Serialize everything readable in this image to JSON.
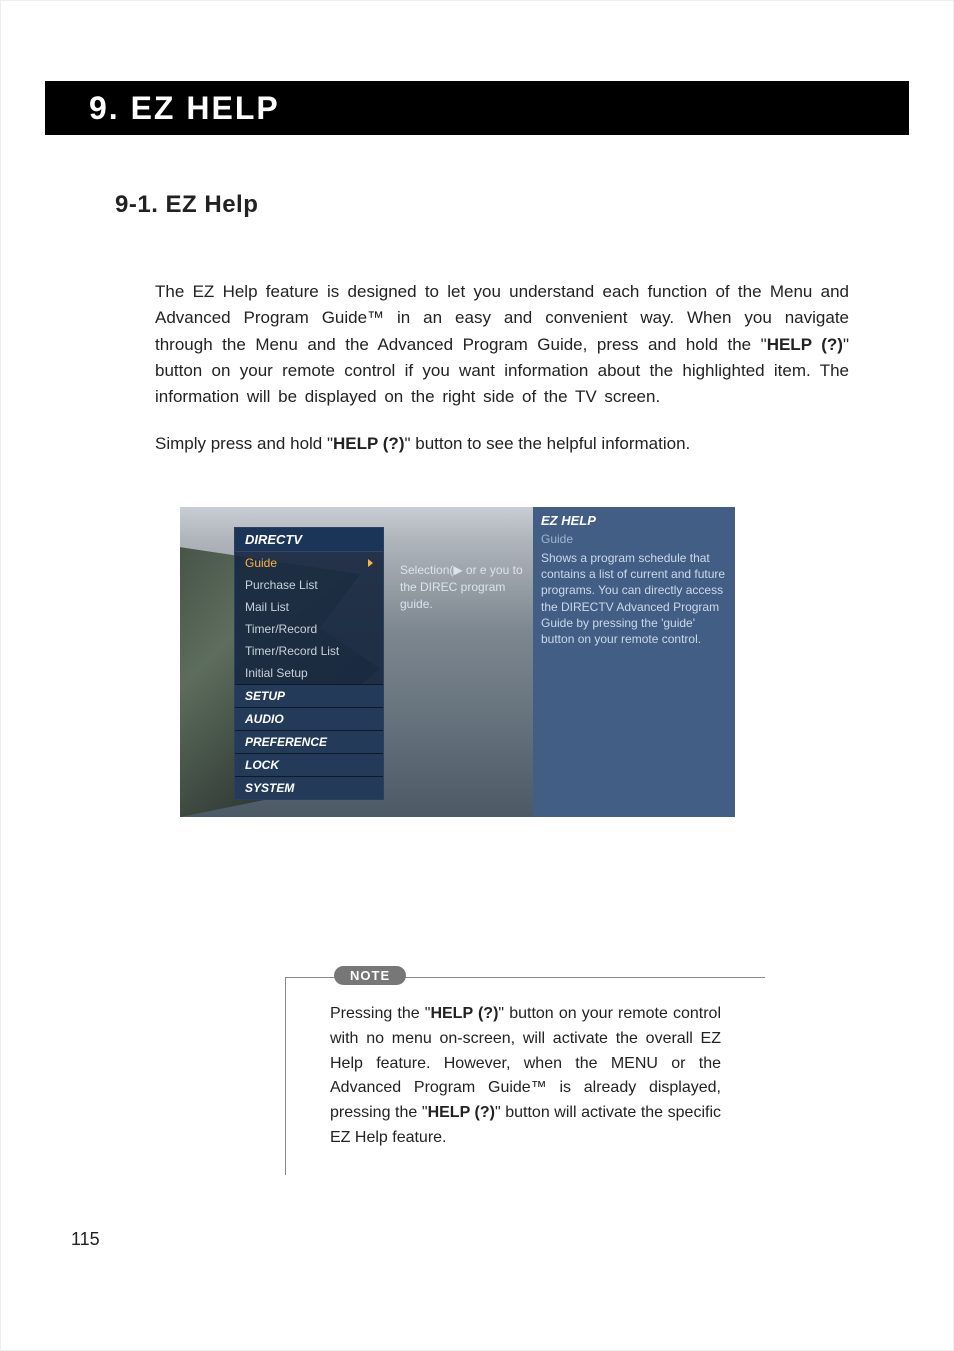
{
  "chapter": {
    "title": "9. EZ HELP"
  },
  "section": {
    "heading": "9-1. EZ Help"
  },
  "paragraphs": {
    "p1a": "The EZ Help feature is designed to let you understand each function of the Menu and Advanced Program Guide™ in an easy and convenient way.  When you navigate through the Menu and the Advanced Program Guide, press and hold the \"",
    "p1b_strong": "HELP (?)",
    "p1c": "\" button on your remote control if you want information about the highlighted item.  The information will be displayed on the right side of the TV screen.",
    "p2a": "Simply press and hold \"",
    "p2b_strong": "HELP (?)",
    "p2c": "\" button to see the helpful information."
  },
  "screenshot": {
    "menu": {
      "title": "DIRECTV",
      "items": [
        "Guide",
        "Purchase List",
        "Mail List",
        "Timer/Record",
        "Timer/Record List",
        "Initial Setup"
      ],
      "active_index": 0,
      "sections": [
        "SETUP",
        "AUDIO",
        "PREFERENCE",
        "LOCK",
        "SYSTEM"
      ]
    },
    "hint": "Selection(▶ or e you to the DIREC program guide.",
    "ezhelp": {
      "title": "EZ HELP",
      "subtitle": "Guide",
      "body": "Shows a program schedule that contains a list of current and future programs. You can directly access the DIRECTV Advanced Program Guide by pressing the 'guide' button on your remote control."
    }
  },
  "note": {
    "label": "NOTE",
    "a": "Pressing the \"",
    "b_strong": "HELP (?)",
    "c": "\" button on your remote control with no menu on-screen, will activate the overall EZ Help feature.  However, when the MENU or the Advanced Program Guide™ is already displayed, pressing the \"",
    "d_strong": "HELP (?)",
    "e": "\" button will activate the specific EZ Help feature."
  },
  "page_number": "115"
}
